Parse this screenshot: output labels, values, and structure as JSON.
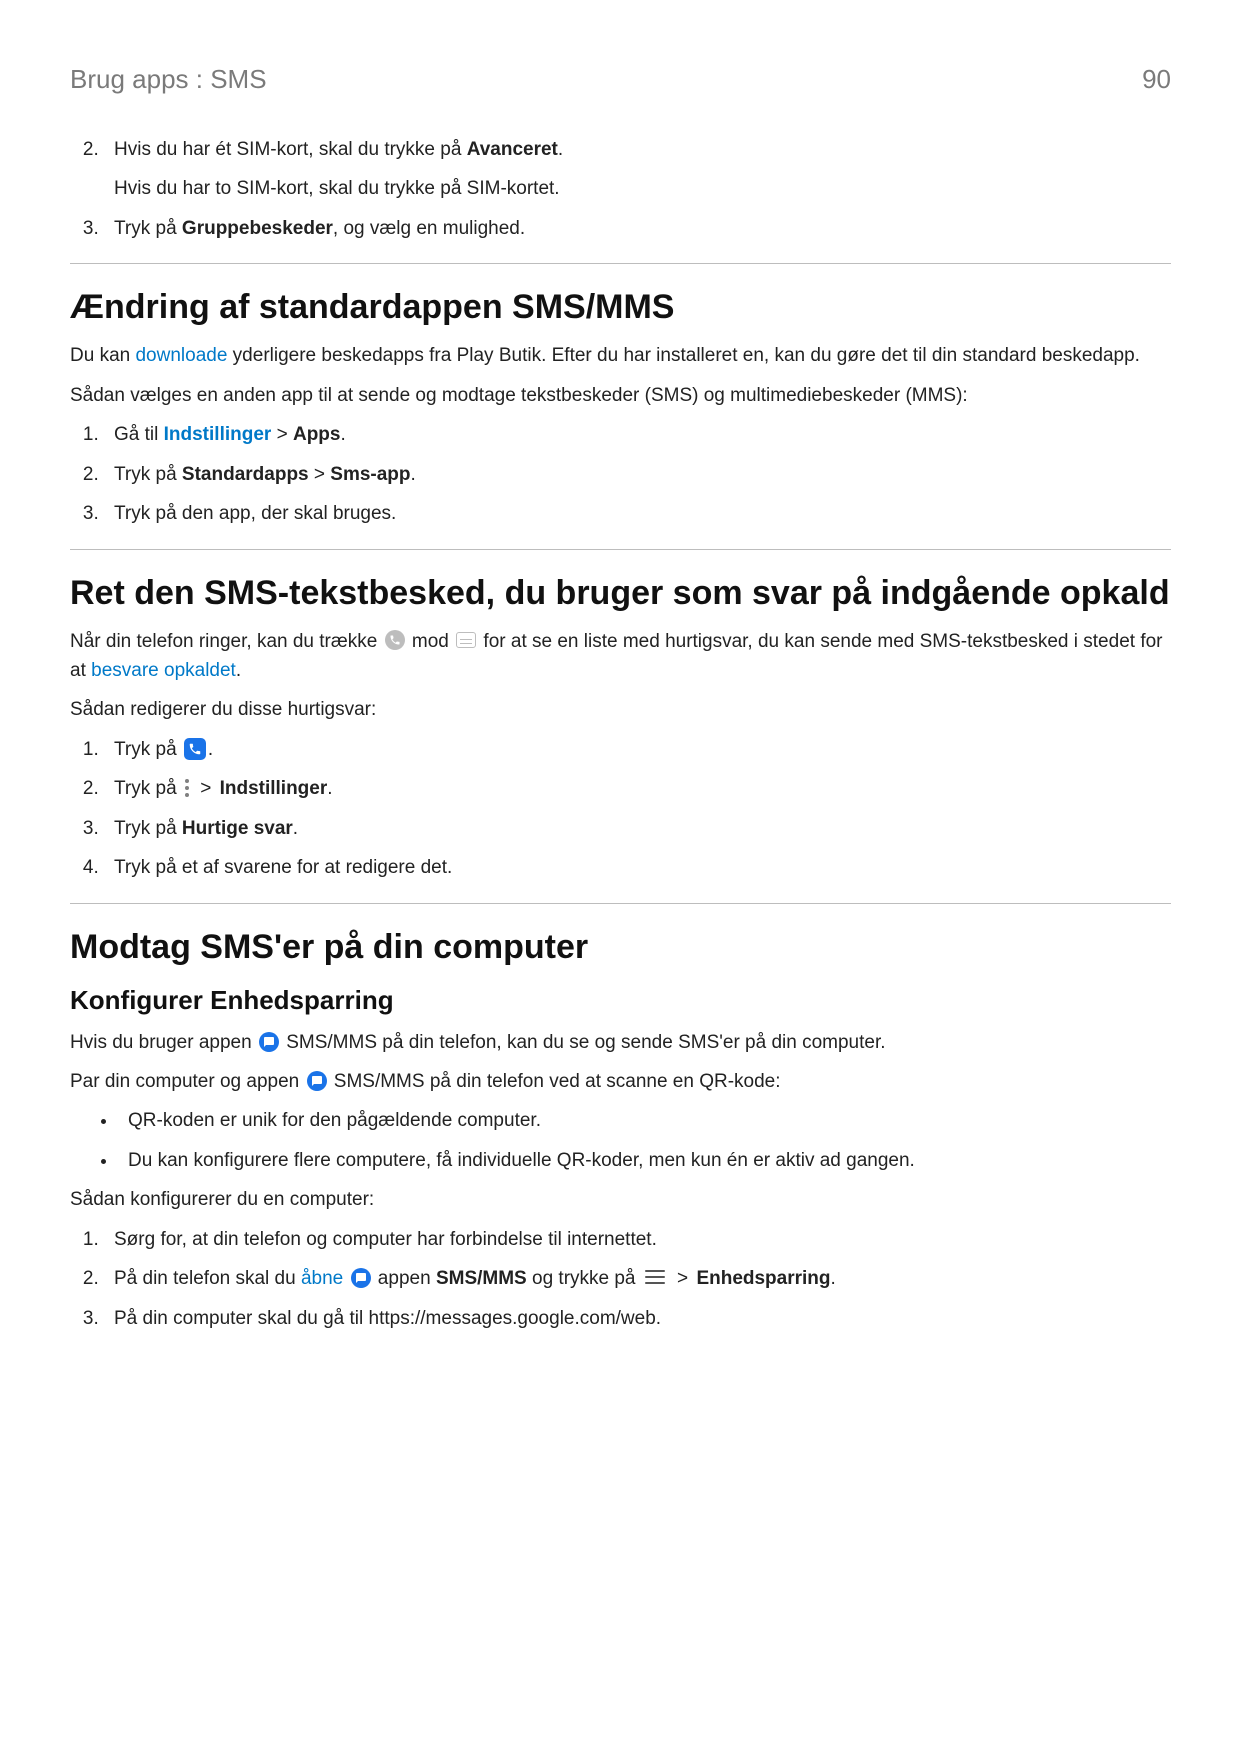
{
  "header": {
    "breadcrumb": "Brug apps : SMS",
    "page_no": "90"
  },
  "top_list": {
    "i2": {
      "pre": "Hvis du har ét SIM-kort, skal du trykke på ",
      "bold": "Avanceret",
      "dot": ".",
      "second": "Hvis du har to SIM-kort, skal du trykke på SIM-kortet."
    },
    "i3": {
      "pre": "Tryk på ",
      "bold": "Gruppebeskeder",
      "post": ", og vælg en mulighed."
    }
  },
  "sec1": {
    "title": "Ændring af standardappen SMS/MMS",
    "p1a": "Du kan ",
    "p1_link": "downloade",
    "p1b": " yderligere beskedapps fra Play Butik. Efter du har installeret en, kan du gøre det til din standard beskedapp.",
    "p2": "Sådan vælges en anden app til at sende og modtage tekstbeskeder (SMS) og multimediebeskeder (MMS):",
    "li1": {
      "pre": "Gå til ",
      "link": "Indstillinger",
      "gt": " > ",
      "bold": "Apps",
      "dot": "."
    },
    "li2": {
      "pre": "Tryk på ",
      "bold1": "Standardapps",
      "gt": " > ",
      "bold2": "Sms-app",
      "dot": "."
    },
    "li3": "Tryk på den app, der skal bruges."
  },
  "sec2": {
    "title": "Ret den SMS-tekstbesked, du bruger som svar på indgående opkald",
    "p1a": "Når din telefon ringer, kan du trække ",
    "p1b": " mod ",
    "p1c": " for at se en liste med hurtigsvar, du kan sende med SMS-tekstbesked i stedet for at ",
    "p1_link": "besvare opkaldet",
    "p1d": ".",
    "p2": "Sådan redigerer du disse hurtigsvar:",
    "li1": {
      "pre": "Tryk på ",
      "dot": "."
    },
    "li2": {
      "pre": "Tryk på ",
      "gt": " > ",
      "bold": "Indstillinger",
      "dot": "."
    },
    "li3": {
      "pre": "Tryk på ",
      "bold": "Hurtige svar",
      "dot": "."
    },
    "li4": "Tryk på et af svarene for at redigere det."
  },
  "sec3": {
    "title": "Modtag SMS'er på din computer",
    "sub": "Konfigurer Enhedsparring",
    "p1a": "Hvis du bruger appen ",
    "p1b": " SMS/MMS på din telefon, kan du se og sende SMS'er på din computer.",
    "p2a": "Par din computer og appen ",
    "p2b": "SMS/MMS på din telefon ved at scanne en QR-kode:",
    "b1": "QR-koden er unik for den pågældende computer.",
    "b2": "Du kan konfigurere flere computere, få individuelle QR-koder, men kun én er aktiv ad gangen.",
    "p3": "Sådan konfigurerer du en computer:",
    "li1": "Sørg for, at din telefon og computer har forbindelse til internettet.",
    "li2": {
      "pre": "På din telefon skal du ",
      "link": "åbne",
      "sp": " ",
      "mid": " appen ",
      "bold1": "SMS/MMS",
      "and": " og trykke på ",
      "gt": " > ",
      "bold2": "Enhedsparring",
      "dot": "."
    },
    "li3": "På din computer skal du gå til https://messages.google.com/web."
  }
}
